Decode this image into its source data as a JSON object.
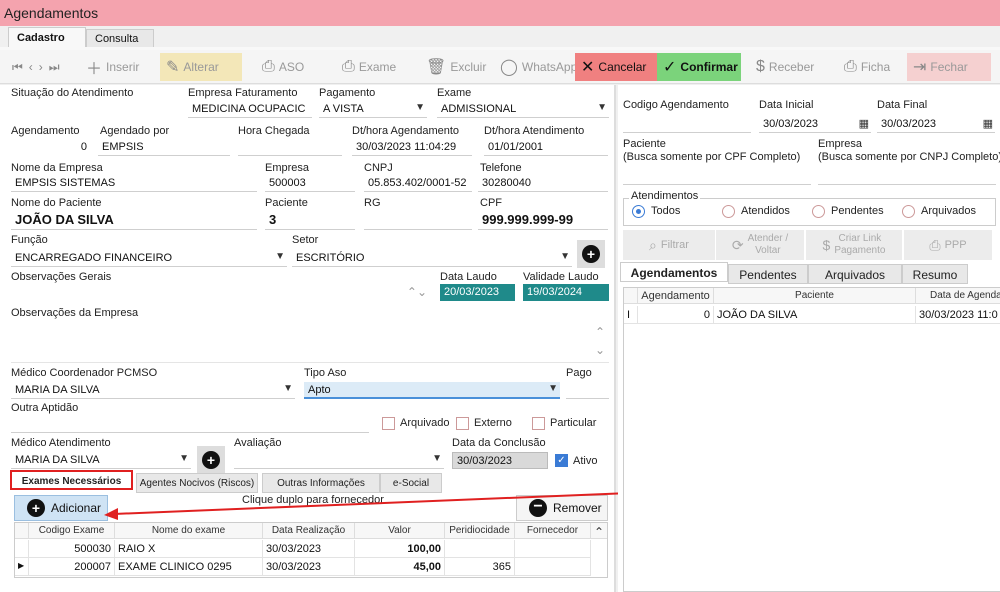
{
  "window": {
    "title": "Agendamentos"
  },
  "tabs": [
    "Cadastro",
    "Consulta"
  ],
  "toolbar": {
    "insert": "Inserir",
    "edit": "Alterar",
    "aso": "ASO",
    "exam": "Exame",
    "delete": "Excluir",
    "whatsapp": "WhatsApp",
    "cancel": "Cancelar",
    "confirm": "Confirmar",
    "receive": "Receber",
    "sheet": "Ficha",
    "close": "Fechar"
  },
  "form": {
    "situacao_label": "Situação do Atendimento",
    "empresa_fat_label": "Empresa Faturamento",
    "empresa_fat_value": "MEDICINA OCUPACIC",
    "pagamento_label": "Pagamento",
    "pagamento_value": "A VISTA",
    "exame_label": "Exame",
    "exame_value": "ADMISSIONAL",
    "agendamento_label": "Agendamento",
    "agendamento_value": "0",
    "agendado_por_label": "Agendado por",
    "agendado_por_value": "EMPSIS",
    "hora_chegada_label": "Hora Chegada",
    "dt_agendamento_label": "Dt/hora Agendamento",
    "dt_agendamento_value": "30/03/2023 11:04:29",
    "dt_atendimento_label": "Dt/hora Atendimento",
    "dt_atendimento_value": "01/01/2001",
    "nome_empresa_label": "Nome da Empresa",
    "nome_empresa_value": "EMPSIS SISTEMAS",
    "empresa_label": "Empresa",
    "empresa_value": "500003",
    "cnpj_label": "CNPJ",
    "cnpj_value": "05.853.402/0001-52",
    "telefone_label": "Telefone",
    "telefone_value": "30280040",
    "nome_paciente_label": "Nome do Paciente",
    "nome_paciente_value": "JOÃO DA SILVA",
    "paciente_label": "Paciente",
    "paciente_value": "3",
    "rg_label": "RG",
    "cpf_label": "CPF",
    "cpf_value": "999.999.999-99",
    "funcao_label": "Função",
    "funcao_value": "ENCARREGADO FINANCEIRO",
    "setor_label": "Setor",
    "setor_value": "ESCRITÓRIO",
    "obs_gerais_label": "Observações Gerais",
    "data_laudo_label": "Data Laudo",
    "data_laudo_value": "20/03/2023",
    "validade_laudo_label": "Validade Laudo",
    "validade_laudo_value": "19/03/2024",
    "obs_empresa_label": "Observações da Empresa",
    "medico_coord_label": "Médico Coordenador PCMSO",
    "medico_coord_value": "MARIA DA SILVA",
    "tipo_aso_label": "Tipo Aso",
    "tipo_aso_value": "Apto",
    "pago_label": "Pago",
    "outra_aptidao_label": "Outra Aptidão",
    "arquivado_label": "Arquivado",
    "externo_label": "Externo",
    "particular_label": "Particular",
    "medico_atend_label": "Médico Atendimento",
    "medico_atend_value": "MARIA DA SILVA",
    "avaliacao_label": "Avaliação",
    "data_conclusao_label": "Data da Conclusão",
    "data_conclusao_value": "30/03/2023",
    "ativo_label": "Ativo"
  },
  "subtabs": [
    "Exames Necessários",
    "Agentes Nocivos (Riscos)",
    "Outras Informações",
    "e-Social"
  ],
  "exams": {
    "add": "Adicionar",
    "hint": "Clique duplo para fornecedor",
    "remove": "Remover",
    "columns": [
      "Codigo Exame",
      "Nome do exame",
      "Data Realização",
      "Valor",
      "Peridiocidade",
      "Fornecedor"
    ],
    "rows": [
      [
        "500030",
        "RAIO X",
        "30/03/2023",
        "100,00",
        "",
        ""
      ],
      [
        "200007",
        "EXAME CLINICO 0295",
        "30/03/2023",
        "45,00",
        "365",
        ""
      ]
    ]
  },
  "right": {
    "codigo_label": "Codigo Agendamento",
    "data_inicial_label": "Data Inicial",
    "data_inicial_value": "30/03/2023",
    "data_final_label": "Data Final",
    "data_final_value": "30/03/2023",
    "paciente_label": "Paciente",
    "paciente_hint": "(Busca somente por CPF Completo)",
    "empresa_label": "Empresa",
    "empresa_hint": "(Busca somente por CNPJ Completo)",
    "atendimentos_label": "Atendimentos",
    "radios": [
      "Todos",
      "Atendidos",
      "Pendentes",
      "Arquivados"
    ],
    "filtrar": "Filtrar",
    "atender1": "Atender /",
    "atender2": "Voltar",
    "criar1": "Criar Link",
    "criar2": "Pagamento",
    "ppp": "PPP",
    "tabs": [
      "Agendamentos",
      "Pendentes",
      "Arquivados",
      "Resumo"
    ],
    "columns": [
      "Agendamento",
      "Paciente",
      "Data de Agendar"
    ],
    "row": {
      "marker": "I",
      "agendamento": "0",
      "paciente": "JOÃO DA SILVA",
      "data": "30/03/2023 11:0"
    }
  },
  "colors": {
    "title": "#f4a3ae",
    "teal": "#1f8a8a",
    "cancel": "#f08080",
    "confirm": "#7bd37b",
    "highlight": "#e02020"
  }
}
